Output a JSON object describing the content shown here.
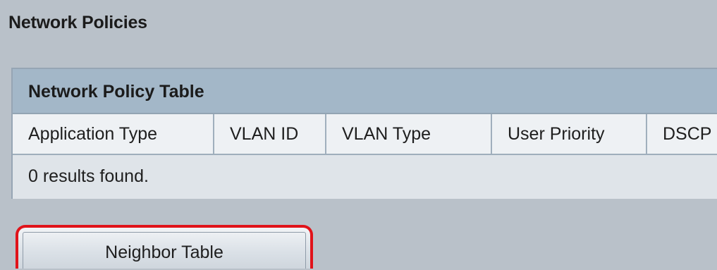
{
  "page": {
    "title": "Network Policies"
  },
  "network_policy_table": {
    "caption": "Network Policy Table",
    "columns": [
      "Application Type",
      "VLAN ID",
      "VLAN Type",
      "User Priority",
      "DSCP"
    ],
    "empty_message": "0 results found."
  },
  "actions": {
    "neighbor_table_label": "Neighbor Table",
    "highlight_color": "#e0131a"
  },
  "colors": {
    "background": "#b9c1c9",
    "table_caption": "#a3b7c8",
    "header_row": "#eef1f4",
    "results_row": "#dfe4e9"
  }
}
